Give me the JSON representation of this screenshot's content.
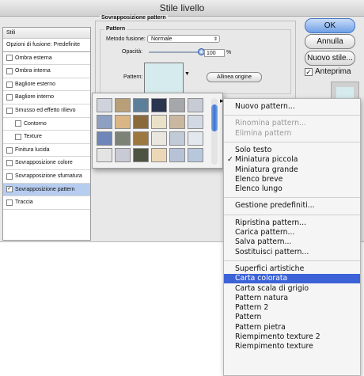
{
  "window": {
    "title": "Stile livello"
  },
  "styles_panel": {
    "header": "Stili",
    "blend_options": "Opzioni di fusione: Predefinite",
    "items": [
      {
        "label": "Ombra esterna",
        "checked": false,
        "indent": false
      },
      {
        "label": "Ombra interna",
        "checked": false,
        "indent": false
      },
      {
        "label": "Bagliore esterno",
        "checked": false,
        "indent": false
      },
      {
        "label": "Bagliore interno",
        "checked": false,
        "indent": false
      },
      {
        "label": "Smusso ed effetto rilievo",
        "checked": false,
        "indent": false
      },
      {
        "label": "Contorno",
        "checked": false,
        "indent": true
      },
      {
        "label": "Texture",
        "checked": false,
        "indent": true
      },
      {
        "label": "Finitura lucida",
        "checked": false,
        "indent": false
      },
      {
        "label": "Sovrapposizione colore",
        "checked": false,
        "indent": false
      },
      {
        "label": "Sovrapposizione sfumatura",
        "checked": false,
        "indent": false
      },
      {
        "label": "Sovrapposizione pattern",
        "checked": true,
        "indent": false,
        "selected": true
      },
      {
        "label": "Traccia",
        "checked": false,
        "indent": false
      }
    ]
  },
  "pattern_overlay": {
    "group_title": "Sovrapposizione pattern",
    "sub_title": "Pattern",
    "blend_mode_label": "Metodo fusione:",
    "blend_mode_value": "Normale",
    "opacity_label": "Opacità:",
    "opacity_value": "100",
    "opacity_unit": "%",
    "opacity_fraction": 1.0,
    "pattern_label": "Pattern:",
    "snap_button": "Allinea origine"
  },
  "buttons": {
    "ok": "OK",
    "cancel": "Annulla",
    "new_style": "Nuovo stile...",
    "preview_label": "Anteprima",
    "preview_checked": true
  },
  "picker": {
    "tile_colors": [
      [
        "#cfd3dc",
        "#b89f78",
        "#5d7f9a",
        "#2a3550",
        "#a6a7aa",
        "#c7cbd4"
      ],
      [
        "#8da0c2",
        "#dab685",
        "#8a6a3d",
        "#e9e2c9",
        "#c9b7a0",
        "#d2d9e2"
      ],
      [
        "#6e86b8",
        "#7c8275",
        "#9d7740",
        "#eae7df",
        "#c1cad7",
        "#e3e8ee"
      ],
      [
        "#e4e4e4",
        "#c8cad6",
        "#4d5442",
        "#ecd8b6",
        "#b6c3d7",
        "#b9c7dc"
      ]
    ]
  },
  "menu": {
    "items": [
      {
        "label": "Nuovo pattern...",
        "state": "normal"
      },
      {
        "sep": true
      },
      {
        "label": "Rinomina pattern...",
        "state": "disabled"
      },
      {
        "label": "Elimina pattern",
        "state": "disabled"
      },
      {
        "sep": true
      },
      {
        "label": "Solo testo",
        "state": "normal"
      },
      {
        "label": "Miniatura piccola",
        "state": "normal",
        "checked": true
      },
      {
        "label": "Miniatura grande",
        "state": "normal"
      },
      {
        "label": "Elenco breve",
        "state": "normal"
      },
      {
        "label": "Elenco lungo",
        "state": "normal"
      },
      {
        "sep": true
      },
      {
        "label": "Gestione predefiniti...",
        "state": "normal"
      },
      {
        "sep": true
      },
      {
        "label": "Ripristina pattern...",
        "state": "normal"
      },
      {
        "label": "Carica pattern...",
        "state": "normal"
      },
      {
        "label": "Salva pattern...",
        "state": "normal"
      },
      {
        "label": "Sostituisci pattern...",
        "state": "normal"
      },
      {
        "sep": true
      },
      {
        "label": "Superfici artistiche",
        "state": "normal"
      },
      {
        "label": "Carta colorata",
        "state": "highlighted"
      },
      {
        "label": "Carta scala di grigio",
        "state": "normal"
      },
      {
        "label": "Pattern natura",
        "state": "normal"
      },
      {
        "label": "Pattern 2",
        "state": "normal"
      },
      {
        "label": "Pattern",
        "state": "normal"
      },
      {
        "label": "Pattern pietra",
        "state": "normal"
      },
      {
        "label": "Riempimento texture 2",
        "state": "normal"
      },
      {
        "label": "Riempimento texture",
        "state": "normal"
      }
    ]
  }
}
